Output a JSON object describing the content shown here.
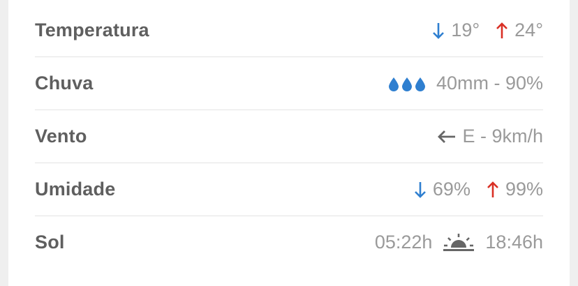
{
  "colors": {
    "arrow_down": "#2f7fd0",
    "arrow_up": "#d93025",
    "drop": "#2f7fd0",
    "icon_gray": "#666666",
    "label": "#5f5f5f",
    "value": "#9a9a9a"
  },
  "rows": {
    "temperatura": {
      "label": "Temperatura",
      "min": "19°",
      "max": "24°",
      "min_icon": "arrow-down-icon",
      "max_icon": "arrow-up-icon"
    },
    "chuva": {
      "label": "Chuva",
      "icon": "raindrops-icon",
      "value": "40mm - 90%"
    },
    "vento": {
      "label": "Vento",
      "icon": "arrow-left-icon",
      "value": "E - 9km/h"
    },
    "umidade": {
      "label": "Umidade",
      "min": "69%",
      "max": "99%",
      "min_icon": "arrow-down-icon",
      "max_icon": "arrow-up-icon"
    },
    "sol": {
      "label": "Sol",
      "sunrise": "05:22h",
      "sunset": "18:46h",
      "icon": "sunrise-sunset-icon"
    }
  }
}
